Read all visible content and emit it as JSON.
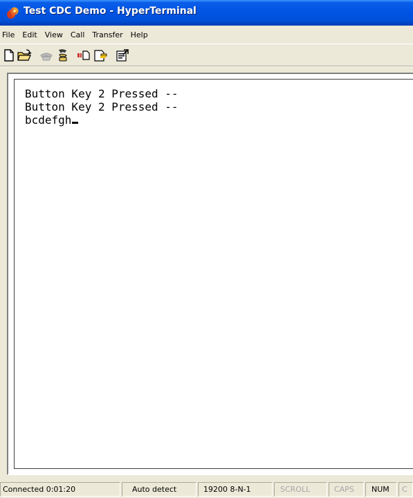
{
  "window": {
    "title": "Test CDC Demo - HyperTerminal",
    "icon": "hyperterminal-app-icon"
  },
  "menu": [
    "File",
    "Edit",
    "View",
    "Call",
    "Transfer",
    "Help"
  ],
  "toolbar": [
    {
      "name": "new-connection",
      "icon": "new-document-icon"
    },
    {
      "name": "open",
      "icon": "open-folder-icon"
    },
    {
      "name": "connect",
      "icon": "phone-icon",
      "disabled": true
    },
    {
      "name": "disconnect",
      "icon": "hang-up-phone-icon"
    },
    {
      "name": "send",
      "icon": "send-file-icon"
    },
    {
      "name": "receive",
      "icon": "receive-file-icon"
    },
    {
      "name": "properties",
      "icon": "properties-icon"
    }
  ],
  "terminal": {
    "lines": [
      "Button Key 2 Pressed --",
      "Button Key 2 Pressed --",
      "bcdefgh"
    ]
  },
  "status": {
    "connected": "Connected 0:01:20",
    "detect": "Auto detect",
    "settings": "19200 8-N-1",
    "scroll": "SCROLL",
    "caps": "CAPS",
    "num": "NUM",
    "capture": "C"
  },
  "colors": {
    "titlebar": "#0054e3",
    "window_face": "#ece9d8",
    "terminal_bg": "#ffffff",
    "indicator_inactive": "#a7a6aa"
  }
}
